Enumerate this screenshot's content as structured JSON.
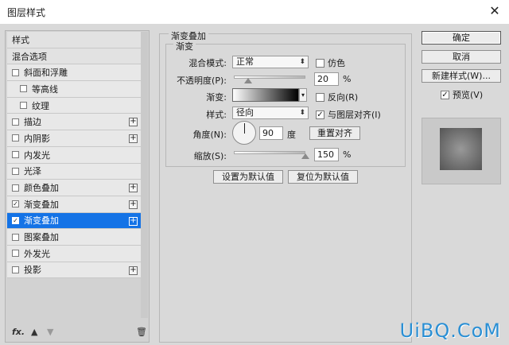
{
  "window": {
    "title": "图层样式",
    "close_icon": "close-icon"
  },
  "styles_panel": {
    "header": "样式",
    "blend_options": "混合选项",
    "items": [
      {
        "label": "斜面和浮雕",
        "checked": false,
        "plus": false,
        "sub": false
      },
      {
        "label": "等高线",
        "checked": false,
        "plus": false,
        "sub": true
      },
      {
        "label": "纹理",
        "checked": false,
        "plus": false,
        "sub": true
      },
      {
        "label": "描边",
        "checked": false,
        "plus": true,
        "sub": false
      },
      {
        "label": "内阴影",
        "checked": false,
        "plus": true,
        "sub": false
      },
      {
        "label": "内发光",
        "checked": false,
        "plus": false,
        "sub": false
      },
      {
        "label": "光泽",
        "checked": false,
        "plus": false,
        "sub": false
      },
      {
        "label": "颜色叠加",
        "checked": false,
        "plus": true,
        "sub": false
      },
      {
        "label": "渐变叠加",
        "checked": true,
        "plus": true,
        "sub": false
      },
      {
        "label": "渐变叠加",
        "checked": true,
        "plus": true,
        "sub": false,
        "selected": true
      },
      {
        "label": "图案叠加",
        "checked": false,
        "plus": false,
        "sub": false
      },
      {
        "label": "外发光",
        "checked": false,
        "plus": false,
        "sub": false
      },
      {
        "label": "投影",
        "checked": false,
        "plus": true,
        "sub": false
      }
    ],
    "footer": {
      "fx": "fx.",
      "up": "▲",
      "down": "▼",
      "delete": "🗑"
    }
  },
  "gradient_overlay": {
    "group_title": "渐变叠加",
    "sub_title": "渐变",
    "blend_mode_label": "混合模式:",
    "blend_mode_value": "正常",
    "dither_label": "仿色",
    "opacity_label": "不透明度(P):",
    "opacity_value": "20",
    "opacity_level": 0.2,
    "opacity_unit": "%",
    "gradient_label": "渐变:",
    "reverse_label": "反向(R)",
    "style_label": "样式:",
    "style_value": "径向",
    "align_label": "与图层对齐(I)",
    "angle_label": "角度(N):",
    "angle_value": "90",
    "angle_unit": "度",
    "reset_align_label": "重置对齐",
    "scale_label": "缩放(S):",
    "scale_value": "150",
    "scale_level": 1.0,
    "scale_unit": "%",
    "set_default_label": "设置为默认值",
    "reset_default_label": "复位为默认值"
  },
  "actions": {
    "ok_label": "确定",
    "cancel_label": "取消",
    "new_style_label": "新建样式(W)...",
    "preview_label": "预览(V)"
  },
  "watermark": "UiBQ.CoM",
  "colors": {
    "accent": "#1473e6",
    "dialog_bg": "#d9d9d9",
    "watermark": "#2a8fd4"
  }
}
